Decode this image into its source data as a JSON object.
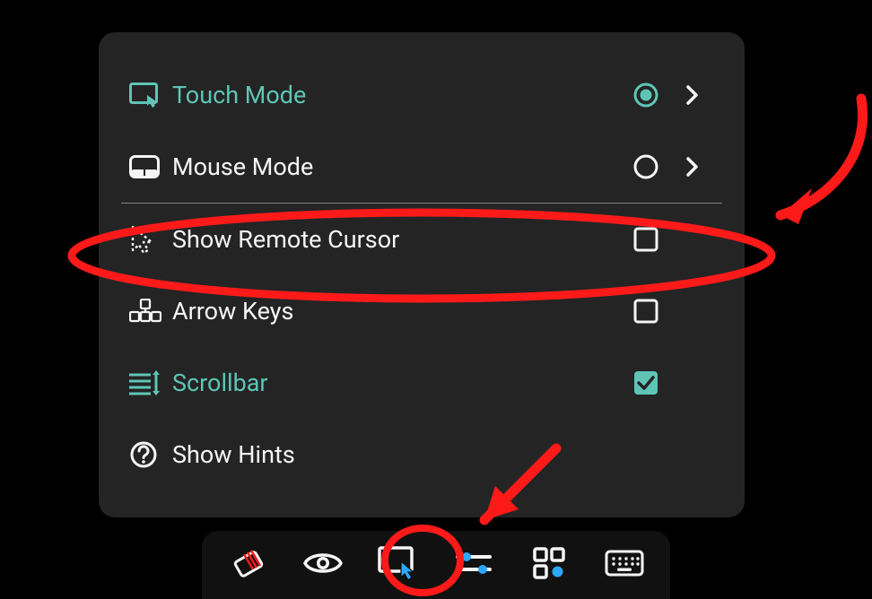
{
  "colors": {
    "accent": "#5ec5b6",
    "text": "#f5f5f5",
    "panel": "#242424",
    "annotation": "#ff1a1a",
    "toolbar_highlight": "#2aa8ff"
  },
  "menu": {
    "items": [
      {
        "id": "touch-mode",
        "label": "Touch Mode",
        "icon": "touch-mode-icon",
        "selected": true,
        "has_submenu": true,
        "control": "radio",
        "accent": true
      },
      {
        "id": "mouse-mode",
        "label": "Mouse Mode",
        "icon": "mouse-mode-icon",
        "selected": false,
        "has_submenu": true,
        "control": "radio",
        "accent": false
      },
      {
        "id": "show-cursor",
        "label": "Show Remote Cursor",
        "icon": "remote-cursor-icon",
        "checked": false,
        "has_submenu": false,
        "control": "checkbox",
        "accent": false
      },
      {
        "id": "arrow-keys",
        "label": "Arrow Keys",
        "icon": "arrow-keys-icon",
        "checked": false,
        "has_submenu": false,
        "control": "checkbox",
        "accent": false
      },
      {
        "id": "scrollbar",
        "label": "Scrollbar",
        "icon": "scrollbar-icon",
        "checked": true,
        "has_submenu": false,
        "control": "checkbox",
        "accent": true
      },
      {
        "id": "show-hints",
        "label": "Show Hints",
        "icon": "help-icon",
        "checked": null,
        "has_submenu": false,
        "control": "none",
        "accent": false
      }
    ]
  },
  "toolbar": {
    "items": [
      {
        "id": "eraser",
        "icon": "eraser-icon",
        "active": false
      },
      {
        "id": "eye",
        "icon": "eye-icon",
        "active": false
      },
      {
        "id": "cursor",
        "icon": "touch-mode-icon",
        "active": true
      },
      {
        "id": "sliders",
        "icon": "sliders-icon",
        "active": false
      },
      {
        "id": "grid",
        "icon": "dashboard-icon",
        "active": false
      },
      {
        "id": "keyboard",
        "icon": "keyboard-icon",
        "active": false
      }
    ]
  },
  "annotations": {
    "circled_menu_item": "show-cursor",
    "circled_toolbar_item": "cursor",
    "arrows": [
      "top-right-to-row",
      "bottom-to-toolbar"
    ]
  }
}
